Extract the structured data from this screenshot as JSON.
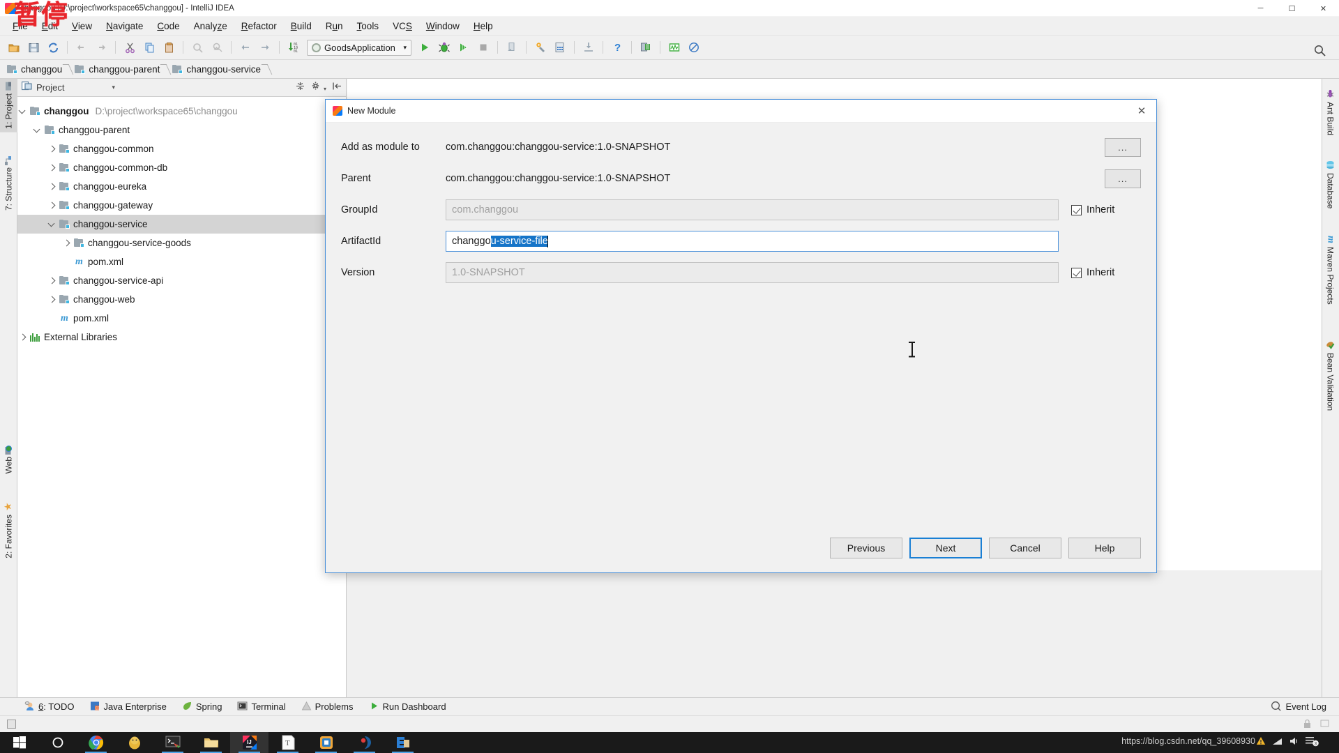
{
  "window": {
    "title": "changgou [D:\\project\\workspace65\\changgou] - IntelliJ IDEA",
    "minimize": "─",
    "maximize": "☐",
    "close": "✕"
  },
  "watermark": {
    "text": "暂停"
  },
  "menubar": {
    "items": [
      {
        "label": "File",
        "mnemonic": "F"
      },
      {
        "label": "Edit",
        "mnemonic": "E"
      },
      {
        "label": "View",
        "mnemonic": "V"
      },
      {
        "label": "Navigate",
        "mnemonic": "N"
      },
      {
        "label": "Code",
        "mnemonic": "C"
      },
      {
        "label": "Analyze",
        "mnemonic": "z"
      },
      {
        "label": "Refactor",
        "mnemonic": "R"
      },
      {
        "label": "Build",
        "mnemonic": "B"
      },
      {
        "label": "Run",
        "mnemonic": "u"
      },
      {
        "label": "Tools",
        "mnemonic": "T"
      },
      {
        "label": "VCS",
        "mnemonic": "S"
      },
      {
        "label": "Window",
        "mnemonic": "W"
      },
      {
        "label": "Help",
        "mnemonic": "H"
      }
    ]
  },
  "toolbar": {
    "icons": [
      "open-folder-icon",
      "save-all-icon",
      "sync-refresh-icon",
      "undo-icon",
      "redo-icon",
      "cut-icon",
      "copy-icon",
      "paste-icon",
      "find-icon",
      "replace-icon",
      "back-icon",
      "forward-icon",
      "compile-icon"
    ],
    "run_config": "GoodsApplication",
    "run_icons": [
      "run-icon",
      "debug-icon",
      "run-coverage-icon",
      "stop-icon",
      "exit-icon",
      "settings-wrench-icon",
      "build-project-icon",
      "update-project-icon",
      "help-icon",
      "database-chip-icon",
      "profiler-icon",
      "no-access-icon"
    ],
    "search_icon": "search-icon"
  },
  "breadcrumb": {
    "items": [
      "changgou",
      "changgou-parent",
      "changgou-service"
    ]
  },
  "left_strip": {
    "tabs": [
      {
        "label": "1: Project",
        "mnemonic": "1",
        "icon": "project-icon",
        "selected": true
      },
      {
        "label": "7: Structure",
        "mnemonic": "7",
        "icon": "structure-icon",
        "selected": false
      },
      {
        "label": "Web",
        "mnemonic": "",
        "icon": "web-icon",
        "selected": false
      },
      {
        "label": "2: Favorites",
        "mnemonic": "2",
        "icon": "star-icon",
        "selected": false
      }
    ]
  },
  "right_strip": {
    "tabs": [
      {
        "label": "Ant Build",
        "icon": "ant-icon"
      },
      {
        "label": "Database",
        "icon": "database-icon"
      },
      {
        "label": "Maven Projects",
        "icon": "maven-icon"
      },
      {
        "label": "Bean Validation",
        "icon": "bean-validation-icon"
      }
    ]
  },
  "project_panel": {
    "header_title": "Project",
    "header_icons": [
      "project-view-icon",
      "chevron-down-icon",
      "collapse-all-icon",
      "settings-gear-icon",
      "hide-panel-icon"
    ],
    "tree": [
      {
        "indent": 0,
        "state": "open",
        "icon": "module-icon",
        "label": "changgou",
        "path": "D:\\project\\workspace65\\changgou",
        "selected": false,
        "bold": true
      },
      {
        "indent": 1,
        "state": "open",
        "icon": "module-icon",
        "label": "changgou-parent",
        "path": "",
        "selected": false,
        "bold": false
      },
      {
        "indent": 2,
        "state": "closed",
        "icon": "module-icon",
        "label": "changgou-common",
        "path": "",
        "selected": false,
        "bold": false
      },
      {
        "indent": 2,
        "state": "closed",
        "icon": "module-icon",
        "label": "changgou-common-db",
        "path": "",
        "selected": false,
        "bold": false
      },
      {
        "indent": 2,
        "state": "closed",
        "icon": "module-icon",
        "label": "changgou-eureka",
        "path": "",
        "selected": false,
        "bold": false
      },
      {
        "indent": 2,
        "state": "closed",
        "icon": "module-icon",
        "label": "changgou-gateway",
        "path": "",
        "selected": false,
        "bold": false
      },
      {
        "indent": 2,
        "state": "open",
        "icon": "module-icon",
        "label": "changgou-service",
        "path": "",
        "selected": true,
        "bold": false
      },
      {
        "indent": 3,
        "state": "closed",
        "icon": "module-icon",
        "label": "changgou-service-goods",
        "path": "",
        "selected": false,
        "bold": false
      },
      {
        "indent": 3,
        "state": "none",
        "icon": "maven-pom-icon",
        "label": "pom.xml",
        "path": "",
        "selected": false,
        "bold": false
      },
      {
        "indent": 2,
        "state": "closed",
        "icon": "module-icon",
        "label": "changgou-service-api",
        "path": "",
        "selected": false,
        "bold": false
      },
      {
        "indent": 2,
        "state": "closed",
        "icon": "module-icon",
        "label": "changgou-web",
        "path": "",
        "selected": false,
        "bold": false
      },
      {
        "indent": 2,
        "state": "none",
        "icon": "maven-pom-icon",
        "label": "pom.xml",
        "path": "",
        "selected": false,
        "bold": false
      },
      {
        "indent": 0,
        "state": "closed",
        "icon": "libraries-icon",
        "label": "External Libraries",
        "path": "",
        "selected": false,
        "bold": false
      }
    ]
  },
  "dialog": {
    "title": "New Module",
    "close_label": "✕",
    "fields": {
      "add_as_module_to": {
        "label": "Add as module to",
        "value": "com.changgou:changgou-service:1.0-SNAPSHOT",
        "button": "..."
      },
      "parent": {
        "label": "Parent",
        "value": "com.changgou:changgou-service:1.0-SNAPSHOT",
        "button": "..."
      },
      "group_id": {
        "label": "GroupId",
        "value": "com.changgou",
        "inherit_label": "Inherit",
        "inherit_checked": true
      },
      "artifact_id": {
        "label": "ArtifactId",
        "value_prefix": "changgo",
        "value_selected": "u-service-file",
        "full_value": "changgou-service-file"
      },
      "version": {
        "label": "Version",
        "value": "1.0-SNAPSHOT",
        "inherit_label": "Inherit",
        "inherit_checked": true
      }
    },
    "buttons": [
      {
        "label": "Previous",
        "focused": false
      },
      {
        "label": "Next",
        "focused": true
      },
      {
        "label": "Cancel",
        "focused": false
      },
      {
        "label": "Help",
        "focused": false
      }
    ]
  },
  "bottom_bar": {
    "items": [
      {
        "label": "6: TODO",
        "mnemonic": "6",
        "icon": "todo-icon"
      },
      {
        "label": "Java Enterprise",
        "mnemonic": "",
        "icon": "java-ee-icon"
      },
      {
        "label": "Spring",
        "mnemonic": "",
        "icon": "spring-leaf-icon"
      },
      {
        "label": "Terminal",
        "mnemonic": "",
        "icon": "terminal-icon"
      },
      {
        "label": "Problems",
        "mnemonic": "",
        "icon": "problems-warning-icon"
      },
      {
        "label": "Run Dashboard",
        "mnemonic": "",
        "icon": "run-dashboard-icon"
      }
    ],
    "event_log": {
      "label": "Event Log",
      "icon": "event-log-icon"
    }
  },
  "taskbar": {
    "items": [
      "windows-start-icon",
      "cortana-search-icon",
      "chrome-icon",
      "qq-icon",
      "cmder-icon",
      "file-explorer-icon",
      "intellij-idea-icon",
      "typora-icon",
      "xshell-icon",
      "navicat-icon",
      "editplus-icon"
    ],
    "url_watermark": "https://blog.csdn.net/qq_39608930",
    "tray": [
      "warning-icon",
      "network-icon",
      "volume-icon",
      "notification-count"
    ]
  }
}
